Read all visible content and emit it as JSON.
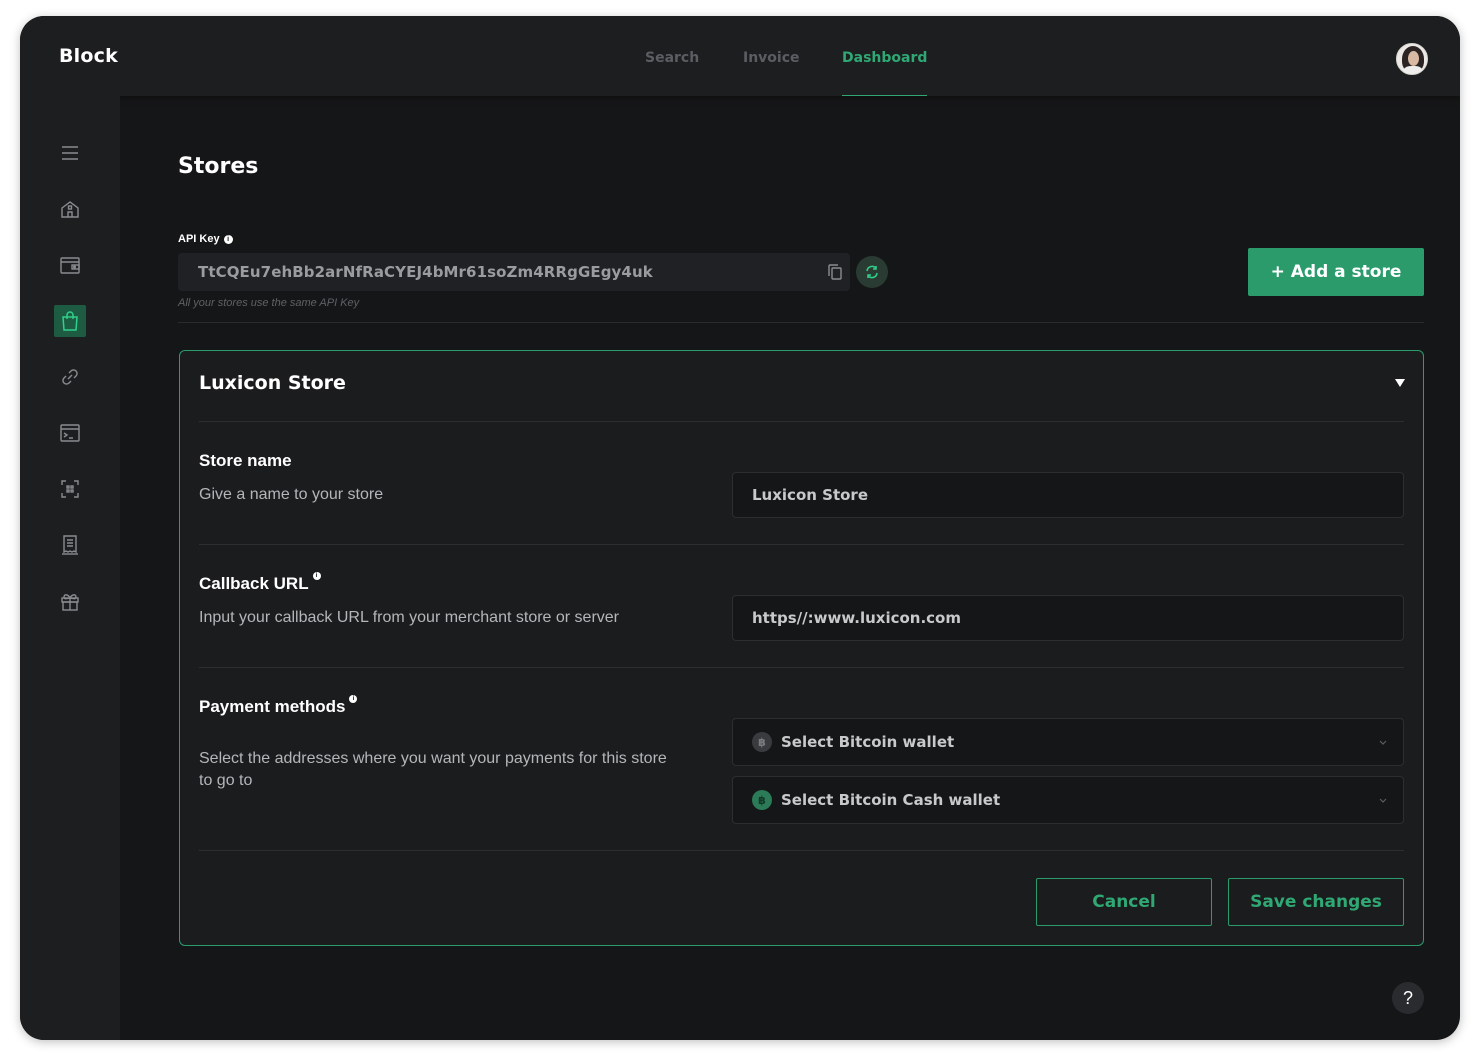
{
  "app": {
    "brand": "Block"
  },
  "nav": {
    "items": [
      "Search",
      "Invoice",
      "Dashboard"
    ],
    "active": "Dashboard"
  },
  "sidebar": {
    "icons": [
      "menu-icon",
      "home-icon",
      "wallet-icon",
      "shopping-bag-icon",
      "link-icon",
      "terminal-icon",
      "scan-icon",
      "receipt-icon",
      "gift-icon"
    ],
    "active": "shopping-bag-icon"
  },
  "page": {
    "title": "Stores"
  },
  "api": {
    "label": "API Key",
    "value": "TtCQEu7ehBb2arNfRaCYEJ4bMr61soZm4RRgGEgy4uk",
    "hint": "All your stores use the same API Key"
  },
  "actions": {
    "add_store": "+ Add a store"
  },
  "store": {
    "title": "Luxicon Store",
    "store_name": {
      "title": "Store name",
      "desc": "Give a name to your store",
      "value": "Luxicon Store"
    },
    "callback": {
      "title": "Callback URL",
      "desc": "Input your callback URL from your merchant store or server",
      "value": "https//:www.luxicon.com"
    },
    "payment": {
      "title": "Payment methods",
      "desc": "Select the addresses where you want your payments for this store to go to",
      "bitcoin": "Select Bitcoin wallet",
      "bitcoin_cash": "Select Bitcoin Cash wallet"
    },
    "cancel": "Cancel",
    "save": "Save changes"
  },
  "help": "?",
  "colors": {
    "accent": "#2b9b6c",
    "background": "#151617",
    "surface": "#1d1e20"
  }
}
